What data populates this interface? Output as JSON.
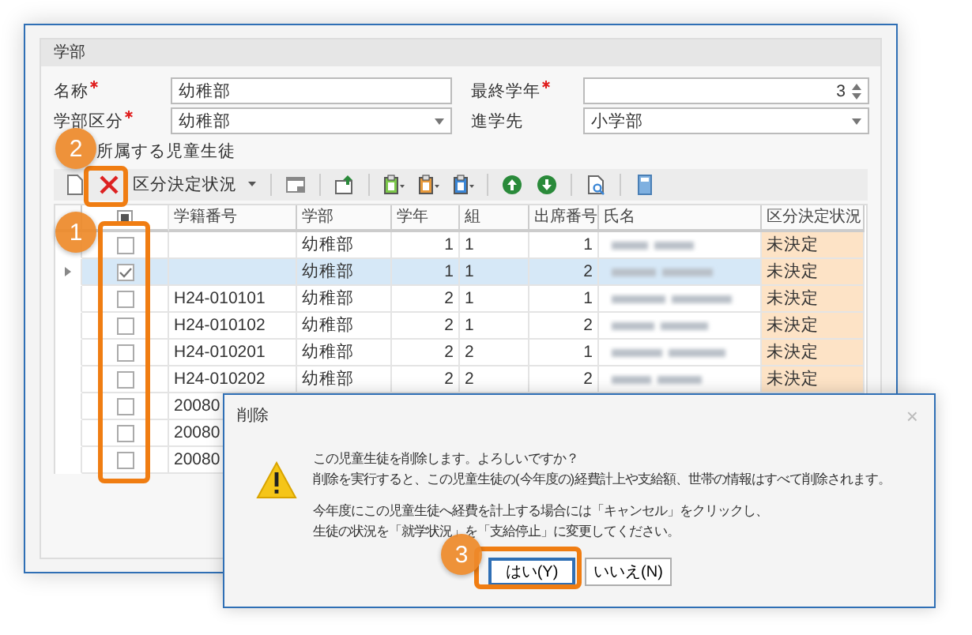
{
  "panel": {
    "title": "学部"
  },
  "fields": [
    {
      "label": "名称",
      "required": true,
      "kind": "text",
      "value": "幼稚部"
    },
    {
      "label": "最終学年",
      "required": true,
      "kind": "spin",
      "value": "3"
    },
    {
      "label": "学部区分",
      "required": true,
      "kind": "select",
      "value": "幼稚部"
    },
    {
      "label": "進学先",
      "required": false,
      "kind": "select",
      "value": "小学部"
    }
  ],
  "students": {
    "title": "所属する児童生徒",
    "toolbar": {
      "dropdown": "区分決定状況"
    },
    "select_all": {
      "indeterminate": true
    },
    "columns": [
      "学籍番号",
      "学部",
      "学年",
      "組",
      "出席番号",
      "氏名",
      "区分決定状況"
    ],
    "rows": [
      {
        "selected": false,
        "checked": false,
        "student_no": "",
        "division": "幼稚部",
        "grade": "1",
        "class": "1",
        "seat": "1",
        "status": "未決定"
      },
      {
        "selected": true,
        "checked": true,
        "student_no": "",
        "division": "幼稚部",
        "grade": "1",
        "class": "1",
        "seat": "2",
        "status": "未決定"
      },
      {
        "selected": false,
        "checked": false,
        "student_no": "H24-010101",
        "division": "幼稚部",
        "grade": "2",
        "class": "1",
        "seat": "1",
        "status": "未決定"
      },
      {
        "selected": false,
        "checked": false,
        "student_no": "H24-010102",
        "division": "幼稚部",
        "grade": "2",
        "class": "1",
        "seat": "2",
        "status": "未決定"
      },
      {
        "selected": false,
        "checked": false,
        "student_no": "H24-010201",
        "division": "幼稚部",
        "grade": "2",
        "class": "2",
        "seat": "1",
        "status": "未決定"
      },
      {
        "selected": false,
        "checked": false,
        "student_no": "H24-010202",
        "division": "幼稚部",
        "grade": "2",
        "class": "2",
        "seat": "2",
        "status": "未決定"
      },
      {
        "selected": false,
        "checked": false,
        "student_no": "20080"
      },
      {
        "selected": false,
        "checked": false,
        "student_no": "20080"
      },
      {
        "selected": false,
        "checked": false,
        "student_no": "20080"
      }
    ]
  },
  "dialog": {
    "title": "削除",
    "close": "×",
    "paragraphs": [
      [
        "この児童生徒を削除します。よろしいですか？",
        "削除を実行すると、この児童生徒の(今年度の)経費計上や支給額、世帯の情報はすべて削除されます。"
      ],
      [
        "今年度にこの児童生徒へ経費を計上する場合には「キャンセル」をクリックし、",
        "生徒の状況を「就学状況」を「支給停止」に変更してください。"
      ]
    ],
    "buttons": [
      {
        "label": "はい(Y)",
        "selected": true
      },
      {
        "label": "いいえ(N)",
        "selected": false
      }
    ]
  },
  "callouts": [
    "1",
    "2",
    "3"
  ]
}
